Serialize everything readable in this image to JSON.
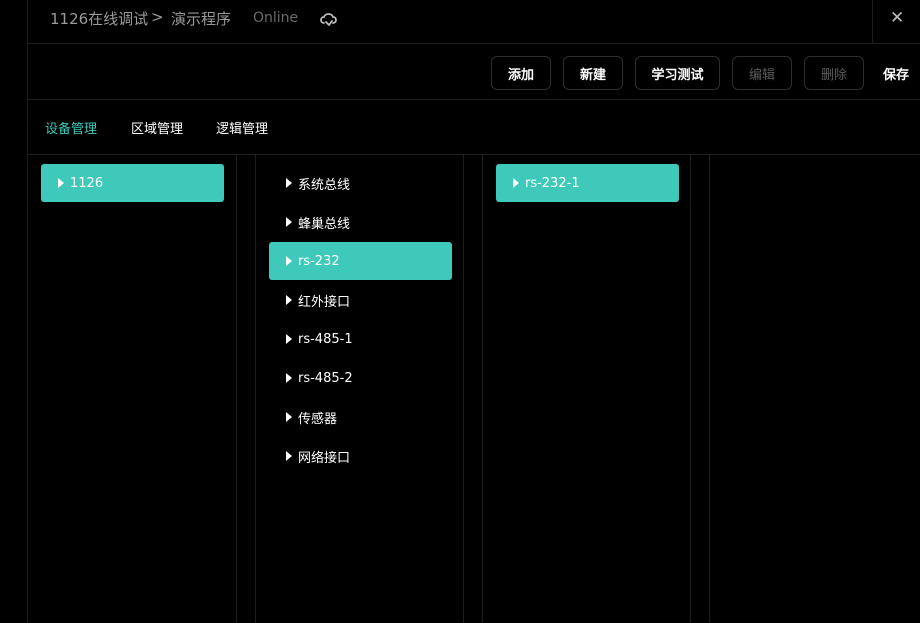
{
  "header": {
    "breadcrumb_parent": "1126在线调试",
    "breadcrumb_separator": ">",
    "breadcrumb_current": "演示程序",
    "status": "Online",
    "status_icon": "cloud-sync-icon",
    "close_icon": "close-icon"
  },
  "toolbar": {
    "add_label": "添加",
    "new_label": "新建",
    "learn_test_label": "学习测试",
    "edit_label": "编辑",
    "delete_label": "删除",
    "save_label": "保存"
  },
  "tabs": [
    {
      "label": "设备管理",
      "active": true
    },
    {
      "label": "区域管理",
      "active": false
    },
    {
      "label": "逻辑管理",
      "active": false
    }
  ],
  "columns": {
    "devices": [
      {
        "label": "1126",
        "selected": true
      }
    ],
    "interfaces": [
      {
        "label": "系统总线",
        "selected": false
      },
      {
        "label": "蜂巢总线",
        "selected": false
      },
      {
        "label": "rs-232",
        "selected": true
      },
      {
        "label": "红外接口",
        "selected": false
      },
      {
        "label": "rs-485-1",
        "selected": false
      },
      {
        "label": "rs-485-2",
        "selected": false
      },
      {
        "label": "传感器",
        "selected": false
      },
      {
        "label": "网络接口",
        "selected": false
      }
    ],
    "sub_items": [
      {
        "label": "rs-232-1",
        "selected": true
      }
    ]
  },
  "colors": {
    "accent": "#3ec9ba",
    "background": "#000000",
    "border": "#1e1e1e"
  }
}
